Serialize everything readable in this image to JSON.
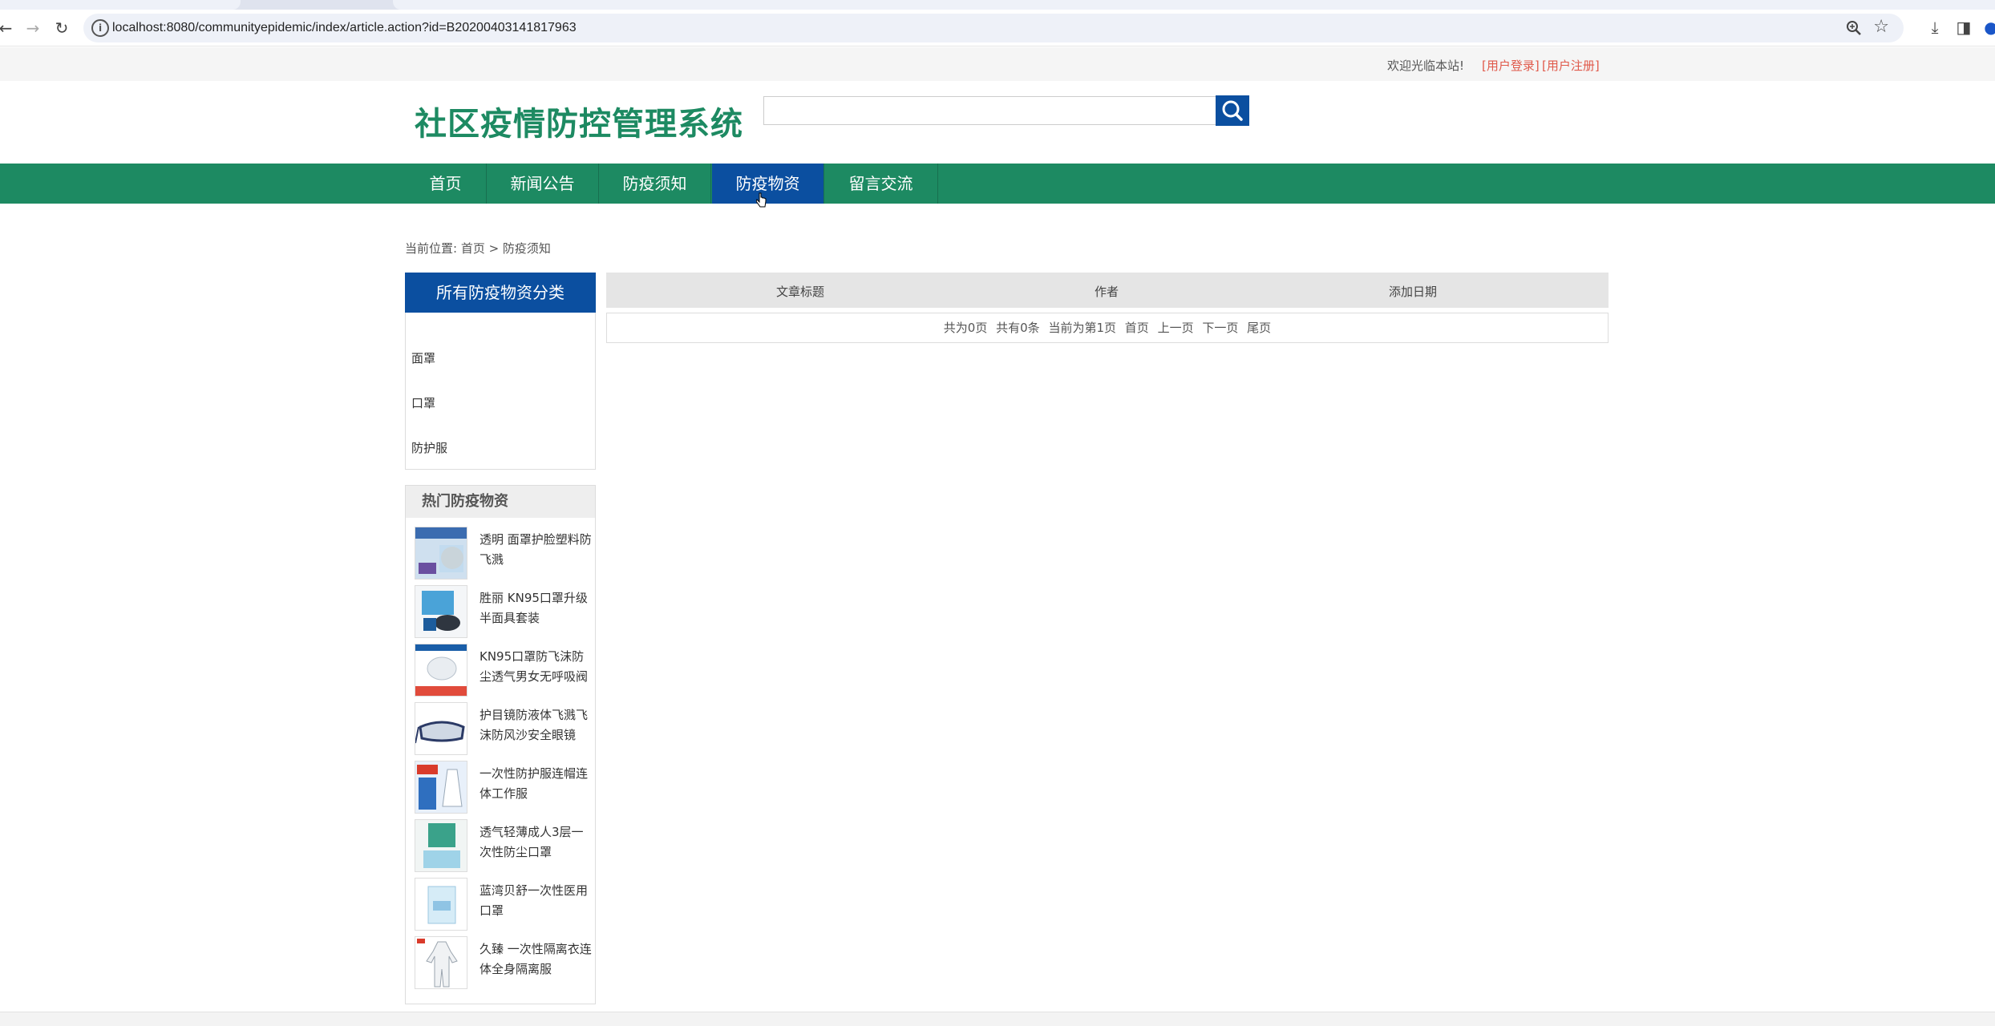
{
  "browser": {
    "url": "localhost:8080/communityepidemic/index/article.action?id=B20200403141817963"
  },
  "topbar": {
    "welcome": "欢迎光临本站!",
    "login": "[用户登录]",
    "register": "[用户注册]"
  },
  "header": {
    "logo": "社区疫情防控管理系统",
    "search_placeholder": ""
  },
  "nav": {
    "items": [
      {
        "label": "首页"
      },
      {
        "label": "新闻公告"
      },
      {
        "label": "防疫须知"
      },
      {
        "label": "防疫物资"
      },
      {
        "label": "留言交流"
      }
    ],
    "active": "防疫物资"
  },
  "breadcrumb": "当前位置: 首页 > 防疫须知",
  "sidebar": {
    "category_title": "所有防疫物资分类",
    "categories": [
      "面罩",
      "口罩",
      "防护服"
    ],
    "hot_title": "热门防疫物资",
    "hot_items": [
      {
        "name": "透明 面罩护脸塑料防飞溅"
      },
      {
        "name": "胜丽 KN95口罩升级半面具套装"
      },
      {
        "name": "KN95口罩防飞沫防尘透气男女无呼吸阀"
      },
      {
        "name": "护目镜防液体飞溅飞沫防风沙安全眼镜"
      },
      {
        "name": "一次性防护服连帽连体工作服"
      },
      {
        "name": "透气轻薄成人3层一次性防尘口罩"
      },
      {
        "name": "蓝湾贝舒一次性医用口罩"
      },
      {
        "name": "久臻 一次性隔离衣连体全身隔离服"
      }
    ]
  },
  "table": {
    "headers": [
      "文章标题",
      "作者",
      "添加日期"
    ],
    "pager": {
      "total_pages": "共为0页",
      "total_items": "共有0条",
      "current": "当前为第1页",
      "first": "首页",
      "prev": "上一页",
      "next": "下一页",
      "last": "尾页"
    }
  },
  "colors": {
    "brand_green": "#1d8a62",
    "accent_blue": "#0b4fa0",
    "link_red": "#e0594a"
  }
}
